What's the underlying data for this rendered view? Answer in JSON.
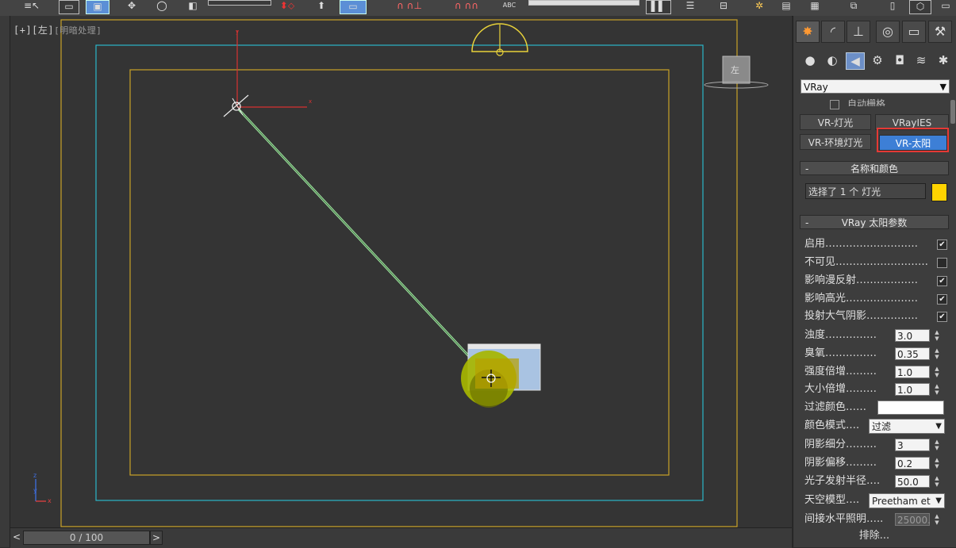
{
  "viewport": {
    "label": "[+][左]",
    "label_sub": "[明暗处理]",
    "timeline_value": "0 / 100",
    "timeline_prev": "<",
    "timeline_next": ">",
    "axis_x": "x",
    "axis_y": "y",
    "axis_z": "z",
    "viewcube_label": "左"
  },
  "panel": {
    "category_value": "VRay",
    "partial_row": "自动栅格",
    "object_types": [
      {
        "label": "VR-灯光"
      },
      {
        "label": "VRayIES"
      },
      {
        "label": "VR-环境灯光"
      },
      {
        "label": "VR-太阳"
      }
    ],
    "name_color": {
      "header": "名称和颜色",
      "name_value": "选择了 1 个 灯光",
      "color": "#ffd400"
    },
    "params": {
      "header": "VRay 太阳参数",
      "enabled": "启用………………………",
      "invisible": "不可见………………………",
      "affect_diffuse": "影响漫反射………………",
      "affect_specular": "影响高光…………………",
      "cast_atmo_shadow": "投射大气阴影……………",
      "turbidity_label": "浊度……………",
      "turbidity_value": "3.0",
      "ozone_label": "臭氧……………",
      "ozone_value": "0.35",
      "intensity_label": "强度倍增………",
      "intensity_value": "1.0",
      "size_label": "大小倍增………",
      "size_value": "1.0",
      "filter_color_label": "过滤颜色……",
      "color_mode_label": "颜色模式….",
      "color_mode_value": "过滤",
      "shadow_subdivs_label": "阴影细分………",
      "shadow_subdivs_value": "3",
      "shadow_bias_label": "阴影偏移………",
      "shadow_bias_value": "0.2",
      "photon_radius_label": "光子发射半径….",
      "photon_radius_value": "50.0",
      "sky_model_label": "天空模型….",
      "sky_model_value": "Preetham et",
      "indirect_horiz_label": "间接水平照明…..",
      "indirect_horiz_value": "25000.",
      "exclude_label": "排除..."
    }
  },
  "colors": {
    "safe_frame_outer": "#c9a227",
    "safe_frame_mid": "#2bb6c9",
    "safe_frame_inner": "#c9a227",
    "sun_beam": "#9fe0a0",
    "selected_tab": "#3d7fd6",
    "highlight_box": "#e53935"
  }
}
